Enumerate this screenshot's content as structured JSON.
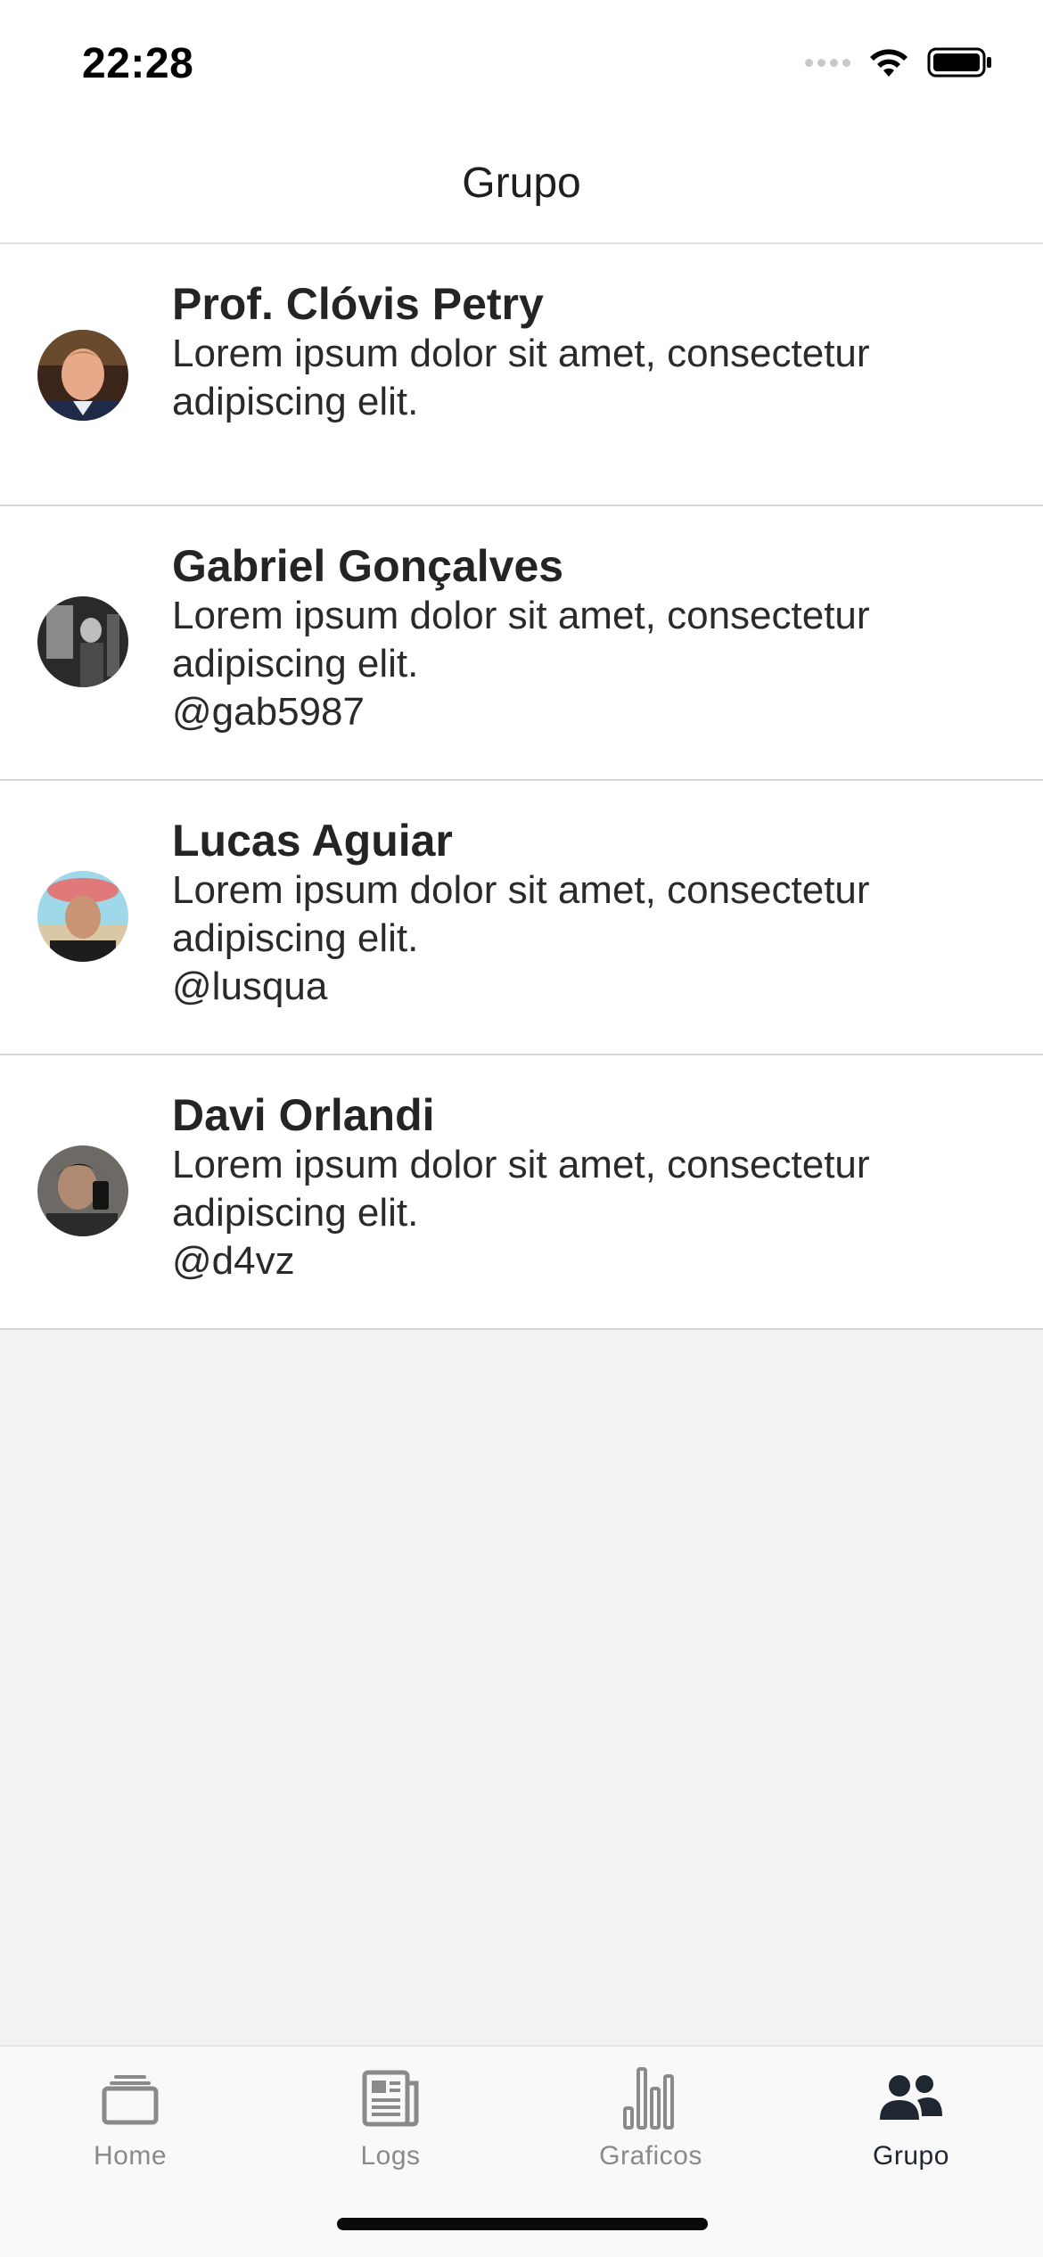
{
  "status_bar": {
    "time": "22:28"
  },
  "header": {
    "title": "Grupo"
  },
  "members": [
    {
      "name": "Prof. Clóvis Petry",
      "description": "Lorem ipsum dolor sit amet, consectetur adipiscing elit.",
      "handle": ""
    },
    {
      "name": "Gabriel Gonçalves",
      "description": "Lorem ipsum dolor sit amet, consectetur adipiscing elit.",
      "handle": "@gab5987"
    },
    {
      "name": "Lucas Aguiar",
      "description": "Lorem ipsum dolor sit amet, consectetur adipiscing elit.",
      "handle": "@lusqua"
    },
    {
      "name": "Davi Orlandi",
      "description": "Lorem ipsum dolor sit amet, consectetur adipiscing elit.",
      "handle": "@d4vz"
    }
  ],
  "tabs": [
    {
      "label": "Home",
      "icon": "layers-icon",
      "active": false
    },
    {
      "label": "Logs",
      "icon": "newspaper-icon",
      "active": false
    },
    {
      "label": "Graficos",
      "icon": "bar-chart-icon",
      "active": false
    },
    {
      "label": "Grupo",
      "icon": "people-icon",
      "active": true
    }
  ],
  "colors": {
    "active_tab": "#1f2733",
    "inactive_tab": "#8a8a8a",
    "background": "#f2f2f2"
  }
}
